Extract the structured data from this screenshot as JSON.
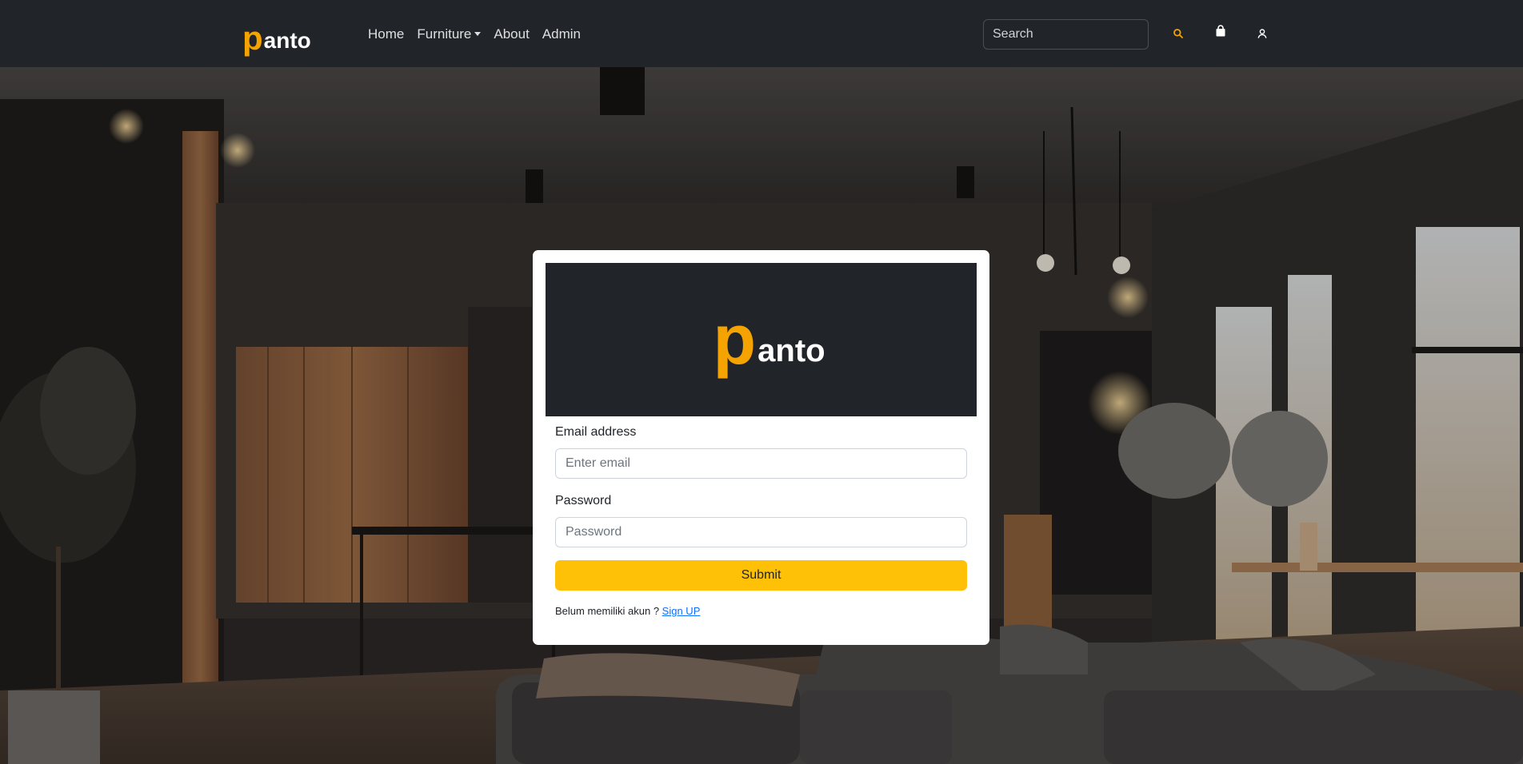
{
  "navbar": {
    "brand": {
      "p": "p",
      "rest": "anto"
    },
    "links": [
      "Home",
      "Furniture",
      "About",
      "Admin"
    ],
    "search_placeholder": "Search",
    "icons": [
      "search-icon",
      "shopping-bag-icon",
      "user-icon"
    ],
    "accent": "#f5a300"
  },
  "login": {
    "logo": {
      "p": "p",
      "rest": "anto"
    },
    "email_label": "Email address",
    "email_placeholder": "Enter email",
    "password_label": "Password",
    "password_placeholder": "Password",
    "submit_label": "Submit",
    "footer_text": "Belum memiliki akun ?",
    "signup_label": "Sign UP"
  },
  "colors": {
    "navbar_bg": "#212529",
    "submit_bg": "#ffc107",
    "link": "#0d6efd"
  }
}
